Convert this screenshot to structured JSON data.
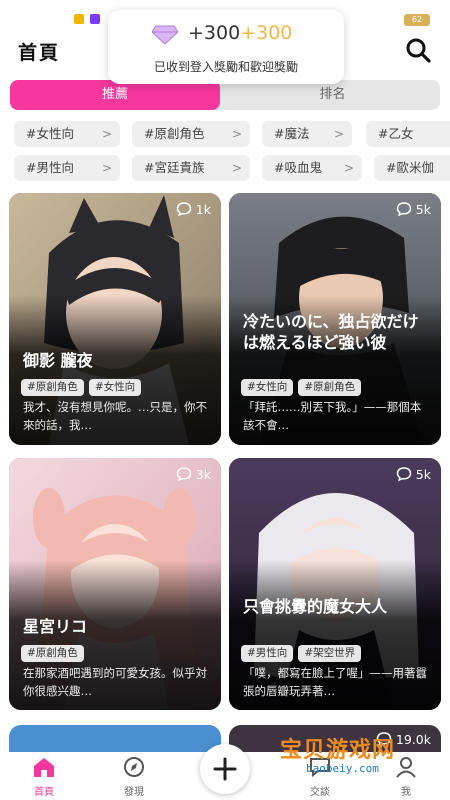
{
  "header": {
    "title": "首頁"
  },
  "status_bar": {
    "battery": "62"
  },
  "toast": {
    "amount": "+300",
    "bonus": "+300",
    "message": "已收到登入獎勵和歡迎獎勵"
  },
  "tabs": [
    {
      "label": "推薦",
      "active": true
    },
    {
      "label": "排名",
      "active": false
    }
  ],
  "chip_rows": [
    [
      "#女性向",
      "#原創角色",
      "#魔法",
      "#乙女"
    ],
    [
      "#男性向",
      "#宮廷貴族",
      "#吸血鬼",
      "#歐米伽"
    ]
  ],
  "cards": [
    {
      "count": "1k",
      "title": "御影 朧夜",
      "tags": [
        "#原創角色",
        "#女性向"
      ],
      "description": "我才、沒有想見你呢。…只是，你不來的話，我…"
    },
    {
      "count": "5k",
      "title": "冷たいのに、独占欲だけは燃えるほど強い彼",
      "tags": [
        "#女性向",
        "#原創角色"
      ],
      "description": "「拜託……別丟下我。」——那個本該不會…"
    },
    {
      "count": "3k",
      "title": "星宮リコ",
      "tags": [
        "#原創角色"
      ],
      "description": "在那家酒吧遇到的可愛女孩。似乎対你很感兴趣…"
    },
    {
      "count": "5k",
      "title": "只會挑釁的魔女大人",
      "tags": [
        "#男性向",
        "#架空世界"
      ],
      "description": "「噗，都寫在臉上了喔」——用著囂張的唇瓣玩弄著…"
    }
  ],
  "partial_cards": [
    {
      "count": "19.0k"
    }
  ],
  "bottom_nav": [
    {
      "label": "首頁",
      "icon": "home-icon",
      "active": true
    },
    {
      "label": "發現",
      "icon": "compass-icon",
      "active": false
    },
    {
      "label": "交談",
      "icon": "chat-icon",
      "active": false
    },
    {
      "label": "我",
      "icon": "profile-icon",
      "active": false
    }
  ],
  "add_button": {
    "icon": "plus-icon"
  },
  "watermark": {
    "text": "宝贝游戏网",
    "url": "baobeiy.com"
  },
  "colors": {
    "accent": "#f7369e",
    "tab_bg": "#e6e6e6",
    "chip_bg": "#efefef"
  }
}
